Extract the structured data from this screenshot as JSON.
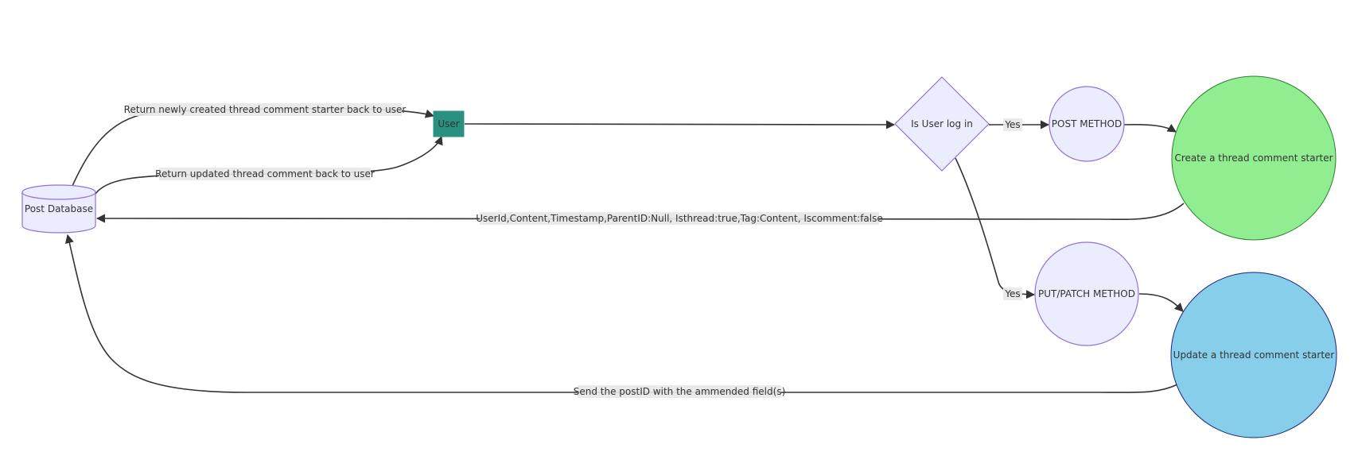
{
  "nodes": {
    "post_database": {
      "label": "Post Database",
      "fill": "#ECECFF",
      "stroke": "#9370DB"
    },
    "user": {
      "label": "User",
      "fill": "#2A9080",
      "stroke": "#2A9080"
    },
    "decision": {
      "label": "Is User log in",
      "fill": "#ECECFF",
      "stroke": "#9370DB"
    },
    "post_method": {
      "label": "POST METHOD",
      "fill": "#ECECFF",
      "stroke": "#9370DB"
    },
    "put_patch_method": {
      "label": "PUT/PATCH METHOD",
      "fill": "#ECECFF",
      "stroke": "#9370DB"
    },
    "create_thread": {
      "label": "Create a thread comment starter",
      "fill": "#90EE90",
      "stroke": "#2E7D32"
    },
    "update_thread": {
      "label": "Update a thread comment starter",
      "fill": "#87CEEB",
      "stroke": "#1A237E"
    }
  },
  "edges": {
    "return_new": "Return newly created thread comment starter back to user",
    "return_updated": "Return updated thread comment back to user",
    "yes_post": "Yes",
    "yes_put": "Yes",
    "create_payload": "UserId,Content,Timestamp,ParentID:Null, Isthread:true,Tag:Content, Iscomment:false",
    "update_payload": "Send the postID with the ammended field(s)"
  }
}
